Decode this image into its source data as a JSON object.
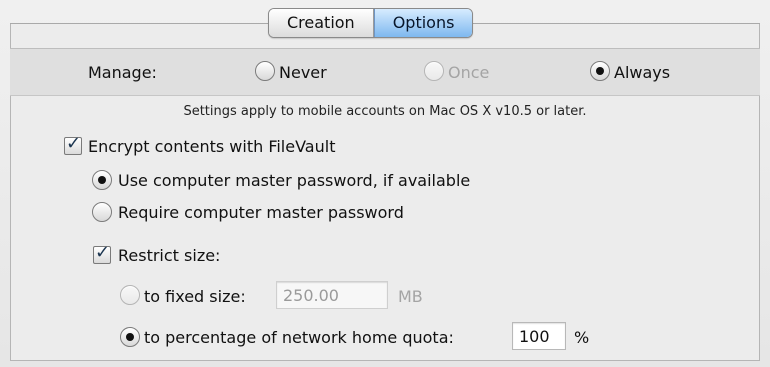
{
  "tabs": [
    {
      "label": "Creation",
      "active": false
    },
    {
      "label": "Options",
      "active": true
    }
  ],
  "manage": {
    "label": "Manage:",
    "options": [
      {
        "label": "Never",
        "selected": false,
        "enabled": true
      },
      {
        "label": "Once",
        "selected": false,
        "enabled": false
      },
      {
        "label": "Always",
        "selected": true,
        "enabled": true
      }
    ]
  },
  "note": "Settings apply to mobile accounts on Mac OS X v10.5 or later.",
  "encrypt": {
    "label": "Encrypt contents with FileVault",
    "checked": true,
    "options": [
      {
        "label": "Use computer master password, if available",
        "selected": true
      },
      {
        "label": "Require computer master password",
        "selected": false
      }
    ]
  },
  "restrict": {
    "label": "Restrict size:",
    "checked": true,
    "fixed": {
      "label": "to fixed size:",
      "value": "250.00",
      "unit": "MB",
      "selected": false,
      "enabled": false
    },
    "percentage": {
      "label": "to percentage of network home quota:",
      "value": "100",
      "unit": "%",
      "selected": true
    }
  }
}
